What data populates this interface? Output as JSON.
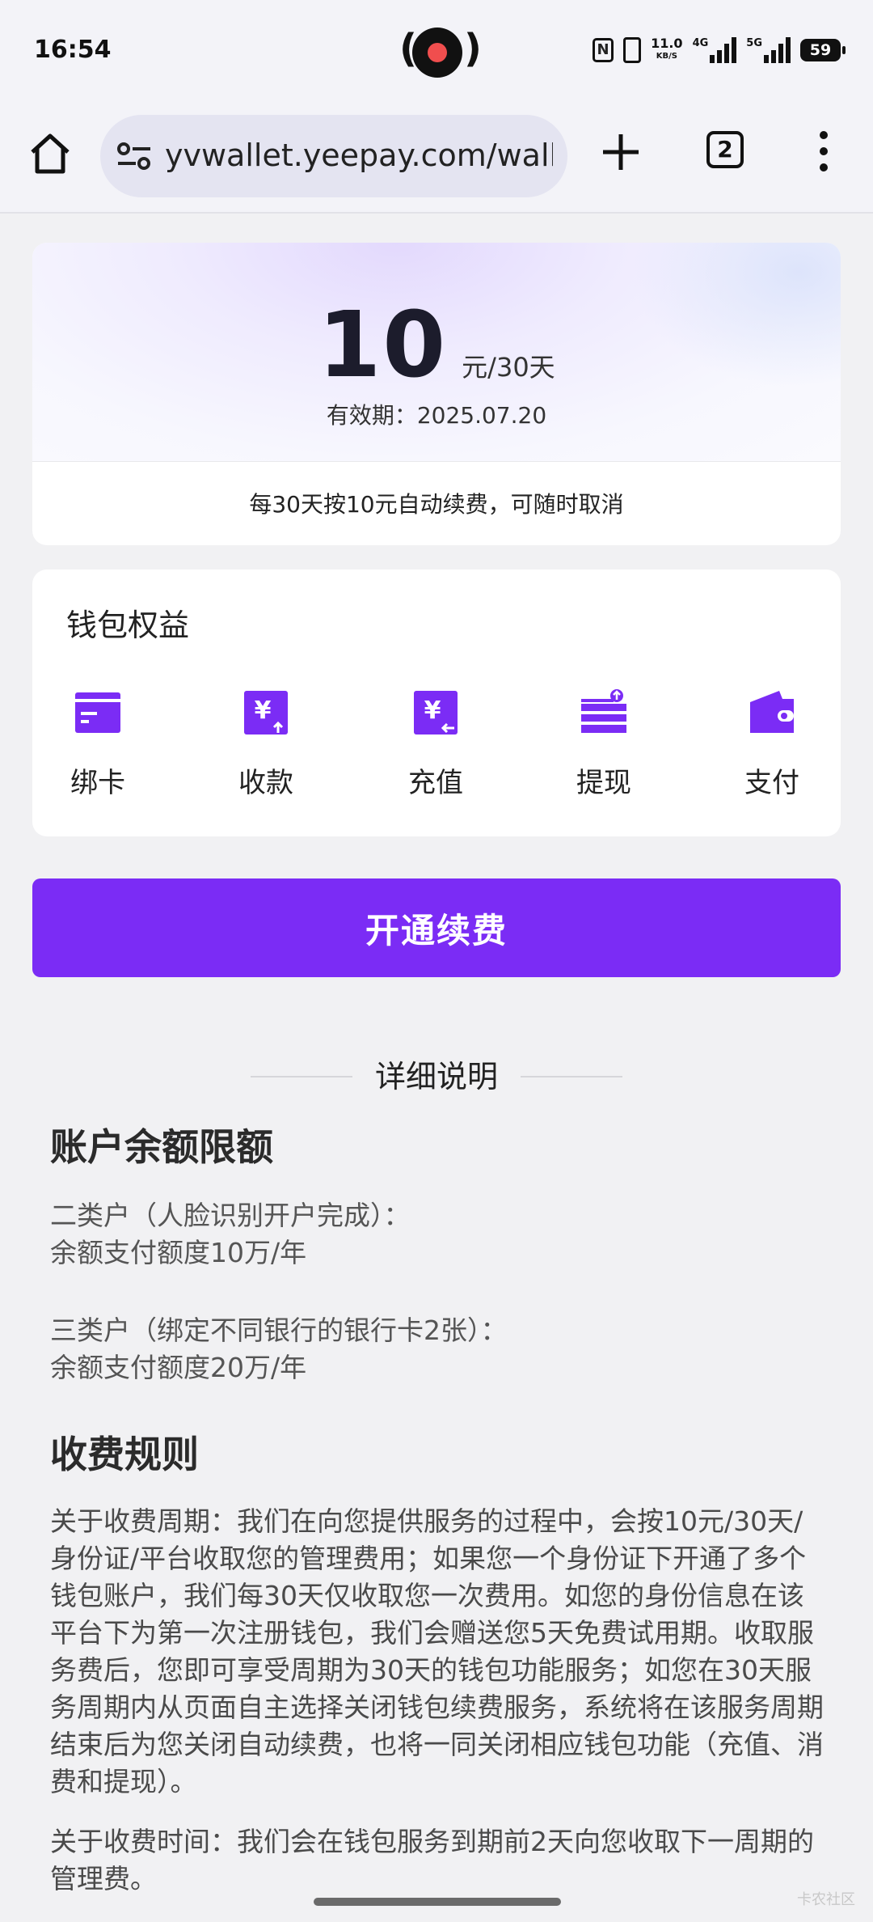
{
  "status_bar": {
    "time": "16:54",
    "nfc": "N",
    "net_speed": "11.0",
    "net_speed_unit": "KB/S",
    "sig1_tag": "4G",
    "sig2_tag": "5G",
    "battery": "59"
  },
  "browser": {
    "url": "yvwallet.yeepay.com/wallet",
    "tab_count": "2",
    "icons": [
      "home-icon",
      "site-settings-icon",
      "plus-icon",
      "tabs-icon",
      "more-vert-icon"
    ]
  },
  "price_card": {
    "amount": "10",
    "unit": "元/30天",
    "validity": "有效期：2025.07.20",
    "renew_note": "每30天按10元自动续费，可随时取消"
  },
  "benefits": {
    "title": "钱包权益",
    "accent_color": "#7b2cf5",
    "items": [
      {
        "label": "绑卡",
        "icon": "bind-card-icon"
      },
      {
        "label": "收款",
        "icon": "receive-money-icon"
      },
      {
        "label": "充值",
        "icon": "recharge-icon"
      },
      {
        "label": "提现",
        "icon": "withdraw-icon"
      },
      {
        "label": "支付",
        "icon": "wallet-pay-icon"
      }
    ]
  },
  "cta": {
    "label": "开通续费",
    "color": "#7b2cf5"
  },
  "details": {
    "heading": "详细说明",
    "balance_title": "账户余额限额",
    "class2_line1": "二类户（人脸识别开户完成）：",
    "class2_line2": "余额支付额度10万/年",
    "class3_line1": "三类户（绑定不同银行的银行卡2张）：",
    "class3_line2": "余额支付额度20万/年",
    "fee_title": "收费规则",
    "fee_period": "关于收费周期：我们在向您提供服务的过程中，会按10元/30天/身份证/平台收取您的管理费用；如果您一个身份证下开通了多个钱包账户，我们每30天仅收取您一次费用。如您的身份信息在该平台下为第一次注册钱包，我们会赠送您5天免费试用期。收取服务费后，您即可享受周期为30天的钱包功能服务；如您在30天服务周期内从页面自主选择关闭钱包续费服务，系统将在该服务周期结束后为您关闭自动续费，也将一同关闭相应钱包功能（充值、消费和提现）。",
    "fee_time": "关于收费时间：我们会在钱包服务到期前2天向您收取下一周期的管理费。"
  },
  "watermark": "卡农社区"
}
